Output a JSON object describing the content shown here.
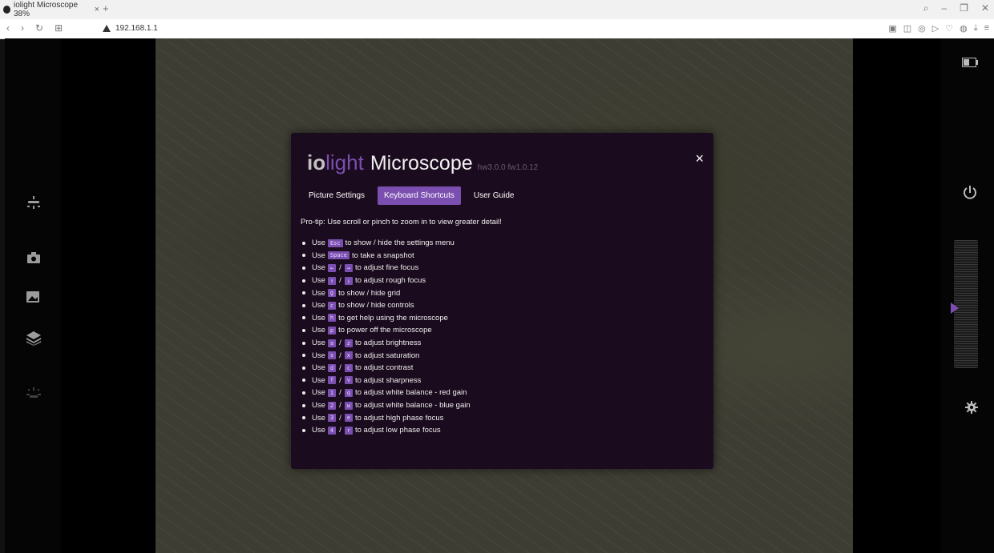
{
  "browser": {
    "tab_title": "iolight Microscope 38%",
    "tab_close": "×",
    "new_tab": "+",
    "url": "192.168.1.1"
  },
  "modal": {
    "brand_io": "io",
    "brand_light": "light",
    "app_name": "Microscope",
    "version": "hw3.0.0 fw1.0.12",
    "close": "×",
    "tabs": [
      {
        "label": "Picture Settings"
      },
      {
        "label": "Keyboard Shortcuts"
      },
      {
        "label": "User Guide"
      }
    ],
    "protip": "Pro-tip: Use scroll or pinch to zoom in to view greater detail!",
    "shortcuts": [
      {
        "use": "Use",
        "keys": [
          "Esc"
        ],
        "text": "to show / hide the settings menu"
      },
      {
        "use": "Use",
        "keys": [
          "Space"
        ],
        "text": "to take a snapshot"
      },
      {
        "use": "Use",
        "keys": [
          "←",
          "→"
        ],
        "text": "to adjust fine focus"
      },
      {
        "use": "Use",
        "keys": [
          "↑",
          "↓"
        ],
        "text": "to adjust rough focus"
      },
      {
        "use": "Use",
        "keys": [
          "g"
        ],
        "text": "to show / hide grid"
      },
      {
        "use": "Use",
        "keys": [
          "c"
        ],
        "text": "to show / hide controls"
      },
      {
        "use": "Use",
        "keys": [
          "h"
        ],
        "text": "to get help using the microscope"
      },
      {
        "use": "Use",
        "keys": [
          "p"
        ],
        "text": "to power off the microscope"
      },
      {
        "use": "Use",
        "keys": [
          "a",
          "z"
        ],
        "text": "to adjust brightness"
      },
      {
        "use": "Use",
        "keys": [
          "s",
          "x"
        ],
        "text": "to adjust saturation"
      },
      {
        "use": "Use",
        "keys": [
          "d",
          "c"
        ],
        "text": "to adjust contrast"
      },
      {
        "use": "Use",
        "keys": [
          "f",
          "v"
        ],
        "text": "to adjust sharpness"
      },
      {
        "use": "Use",
        "keys": [
          "1",
          "q"
        ],
        "text": "to adjust white balance - red gain"
      },
      {
        "use": "Use",
        "keys": [
          "2",
          "w"
        ],
        "text": "to adjust white balance - blue gain"
      },
      {
        "use": "Use",
        "keys": [
          "3",
          "e"
        ],
        "text": "to adjust high phase focus"
      },
      {
        "use": "Use",
        "keys": [
          "4",
          "r"
        ],
        "text": "to adjust low phase focus"
      }
    ],
    "key_separator": "/"
  },
  "colors": {
    "accent": "#7b4fb0",
    "modal_bg": "#1b0b1e"
  },
  "icons": {
    "left": [
      "light-icon",
      "camera-icon",
      "gallery-icon",
      "layers-icon",
      "brightness-icon"
    ],
    "right": [
      "battery-icon",
      "power-icon",
      "gear-icon"
    ]
  }
}
